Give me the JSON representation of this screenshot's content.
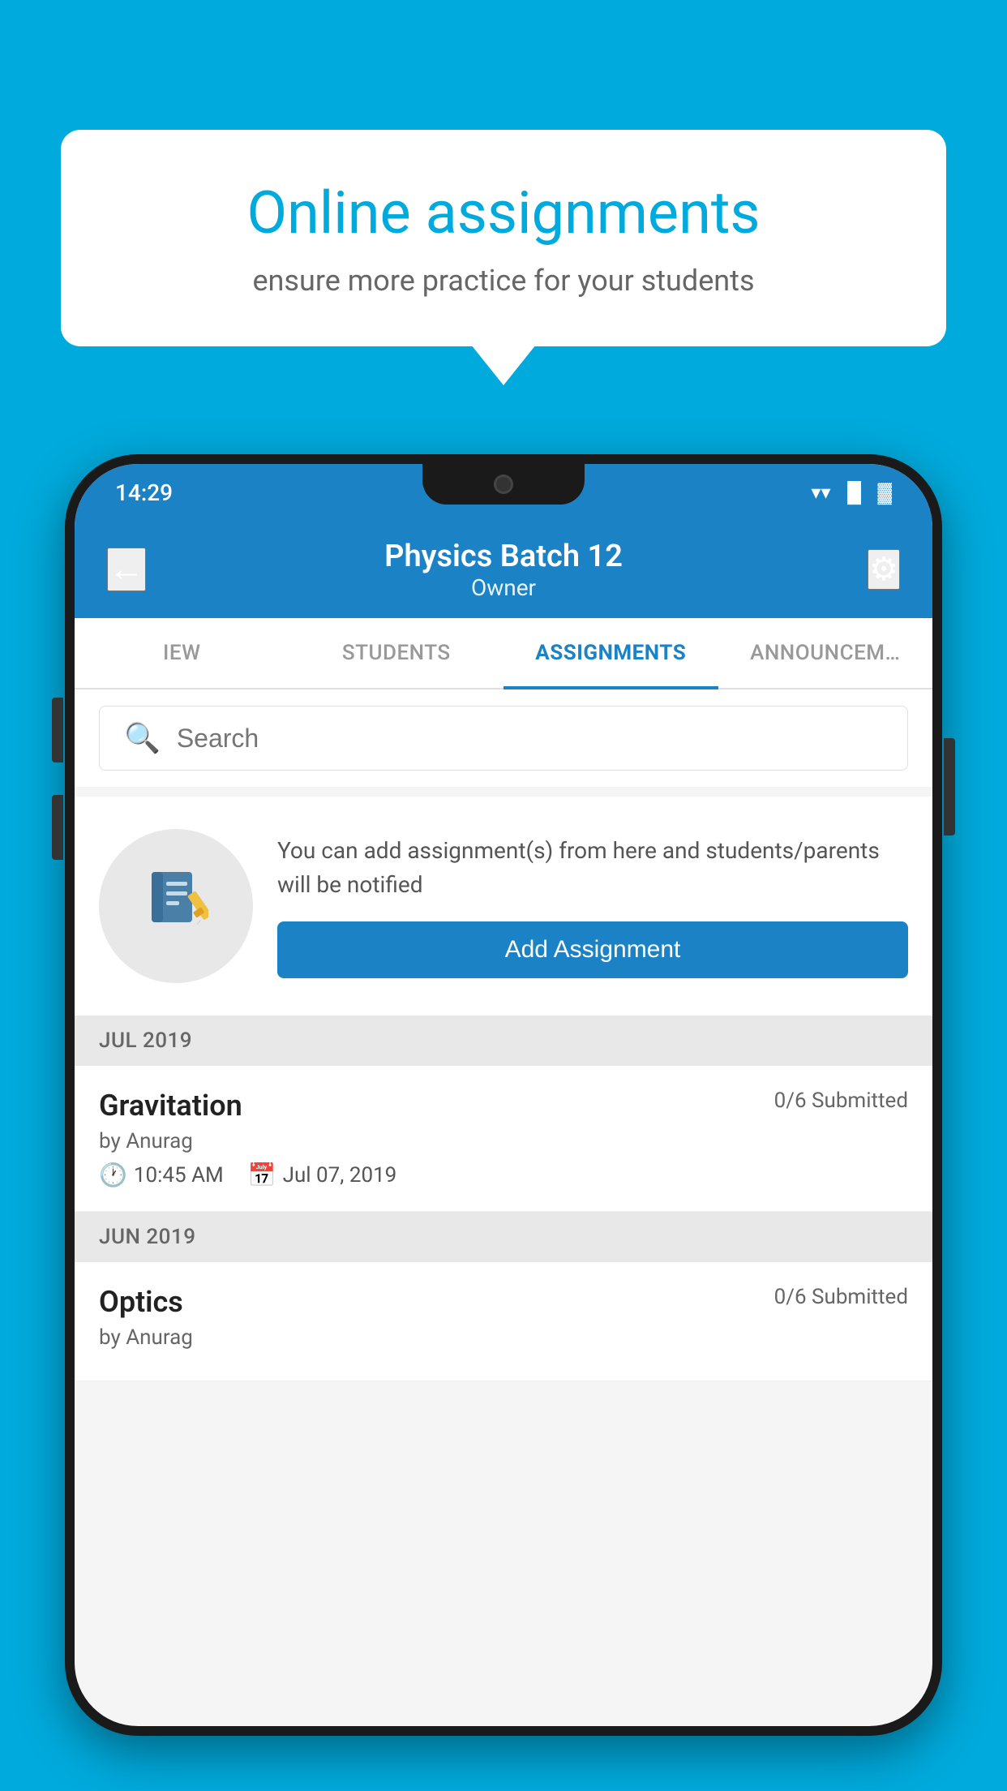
{
  "background": {
    "color": "#00AADC"
  },
  "speech_bubble": {
    "title": "Online assignments",
    "subtitle": "ensure more practice for your students"
  },
  "phone": {
    "status_bar": {
      "time": "14:29",
      "icons": [
        "wifi",
        "signal",
        "battery"
      ]
    },
    "header": {
      "back_label": "←",
      "title": "Physics Batch 12",
      "subtitle": "Owner",
      "settings_icon": "⚙"
    },
    "tabs": [
      {
        "label": "IEW",
        "active": false
      },
      {
        "label": "STUDENTS",
        "active": false
      },
      {
        "label": "ASSIGNMENTS",
        "active": true
      },
      {
        "label": "ANNOUNCEM…",
        "active": false
      }
    ],
    "search": {
      "placeholder": "Search"
    },
    "add_promo": {
      "description": "You can add assignment(s) from here and students/parents will be notified",
      "button_label": "Add Assignment"
    },
    "sections": [
      {
        "header": "JUL 2019",
        "assignments": [
          {
            "name": "Gravitation",
            "submitted": "0/6 Submitted",
            "by": "by Anurag",
            "time": "10:45 AM",
            "date": "Jul 07, 2019"
          }
        ]
      },
      {
        "header": "JUN 2019",
        "assignments": [
          {
            "name": "Optics",
            "submitted": "0/6 Submitted",
            "by": "by Anurag",
            "time": "",
            "date": ""
          }
        ]
      }
    ]
  }
}
